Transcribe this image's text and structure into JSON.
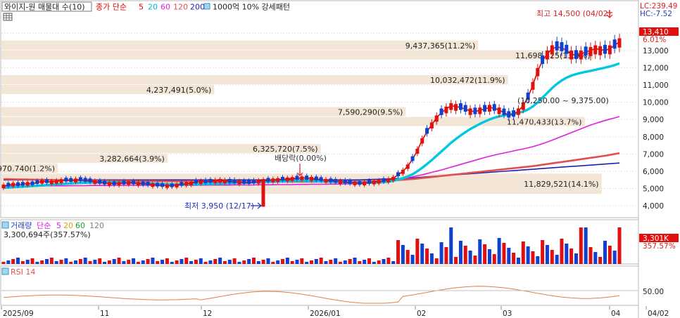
{
  "header": {
    "title": "와이지-원 매물대 수(10)",
    "ma_label": "종가 단순",
    "ma_periods": [
      "5",
      "20",
      "60",
      "120",
      "200"
    ],
    "ma_colors": [
      "#e00000",
      "#00c8e0",
      "#e020e0",
      "#e05050",
      "#2020b0"
    ],
    "extra": "1000억 10% 강세패턴"
  },
  "right_labels": {
    "lc": "LC:239.49",
    "hc": "HC:-7.52",
    "price_tag": "13,410",
    "price_pct": "6.01%",
    "volume_tag": "3,301K",
    "volume_pct": "357.57%"
  },
  "annotations": {
    "high": "최고 14,500 (04/02)",
    "low": "최저 3,950 (12/17)",
    "dividend": "배당락(0.00%)",
    "range": "(10,250.00 ~ 9,375.00)"
  },
  "volume_panel": {
    "title": "거래량",
    "ma_label": "단순",
    "ma_periods": [
      "5",
      "20",
      "60",
      "120"
    ],
    "ma_colors": [
      "#e020e0",
      "#e0a000",
      "#20a020",
      "#808080"
    ],
    "value": "3,300,694주(357.57%)"
  },
  "rsi_panel": {
    "title": "RSI 14",
    "level": "50.00"
  },
  "chart_data": [
    {
      "type": "candlestick",
      "name": "price",
      "y_ticks": [
        "14,000",
        "13,000",
        "12,000",
        "11,000",
        "10,000",
        "9,000",
        "8,000",
        "7,000",
        "6,000",
        "5,000",
        "4,000"
      ],
      "ylim": [
        3400,
        14700
      ],
      "x_labels": [
        "2025/09",
        "11",
        "12",
        "2026/01",
        "02",
        "03",
        "04",
        "04/02"
      ],
      "volume_profile": [
        {
          "label": "970,740(1.2%)",
          "price_low": 5870,
          "price_high": 6440,
          "pct": 1.2
        },
        {
          "label": "3,282,664(3.9%)",
          "price_low": 6440,
          "price_high": 7010,
          "pct": 3.9
        },
        {
          "label": "6,325,720(7.5%)",
          "price_low": 7010,
          "price_high": 7580,
          "pct": 7.5
        },
        {
          "label": "11,470,433(13.7%)",
          "price_low": 8580,
          "price_high": 9150,
          "pct": 13.7
        },
        {
          "label": "7,590,290(9.5%)",
          "price_low": 9150,
          "price_high": 9720,
          "pct": 9.5
        },
        {
          "label": "4,237,491(5.0%)",
          "price_low": 10430,
          "price_high": 11000,
          "pct": 5.0
        },
        {
          "label": "10,032,472(11.9%)",
          "price_low": 11000,
          "price_high": 11570,
          "pct": 11.9
        },
        {
          "label": "11,698,425(13.9%)",
          "price_low": 12430,
          "price_high": 13000,
          "pct": 13.9
        },
        {
          "label": "9,437,365(11.2%)",
          "price_low": 13000,
          "price_high": 13570,
          "pct": 11.2
        },
        {
          "label": "11,829,521(14.1%)",
          "price_low": 4650,
          "price_high": 5870,
          "pct": 14.1
        }
      ],
      "series": [
        {
          "name": "5",
          "values": [
            5150,
            5200,
            5250,
            5230,
            5250,
            5300,
            5280,
            5350,
            5420,
            5400,
            5380,
            5420,
            5460,
            5490,
            5470,
            5500,
            5520,
            5480,
            5450,
            5400,
            5360,
            5320,
            5300,
            5280,
            5300,
            5320,
            5350,
            5330,
            5300,
            5280,
            5260,
            5230,
            5200,
            5180,
            5170,
            5160,
            5200,
            5250,
            5300,
            5320,
            5380,
            5400,
            5390,
            5420,
            5450,
            5480,
            5440,
            5420,
            5400,
            5380,
            5360,
            5350,
            5380,
            5420,
            5460,
            5480,
            5500,
            5520,
            5540,
            5560,
            5580,
            5600,
            5620,
            5610,
            5590,
            5560,
            5520,
            5480,
            5450,
            5420,
            5400,
            5380,
            5350,
            5330,
            5300,
            5320,
            5360,
            5380,
            5420,
            5460,
            5500,
            5600,
            5800,
            6000,
            6300,
            6700,
            7200,
            7800,
            8300,
            8700,
            9100,
            9400,
            9600,
            9800,
            9750,
            9700,
            9600,
            9500,
            9450,
            9550,
            9600,
            9700,
            9650,
            9550,
            9400,
            9250,
            9300,
            9500,
            9800,
            10300,
            11000,
            11800,
            12400,
            12800,
            13100,
            13200,
            13150,
            13000,
            12800,
            12700,
            12800,
            12900,
            13000,
            13100,
            13050,
            13000,
            13100,
            13300,
            13500
          ]
        },
        {
          "name": "20",
          "values": [
            5050,
            5060,
            5080,
            5100,
            5110,
            5130,
            5150,
            5160,
            5180,
            5200,
            5220,
            5240,
            5260,
            5280,
            5300,
            5320,
            5330,
            5340,
            5350,
            5360,
            5370,
            5370,
            5370,
            5360,
            5350,
            5340,
            5330,
            5320,
            5310,
            5300,
            5290,
            5280,
            5270,
            5260,
            5250,
            5240,
            5240,
            5240,
            5240,
            5250,
            5250,
            5260,
            5260,
            5270,
            5280,
            5290,
            5300,
            5310,
            5320,
            5330,
            5340,
            5350,
            5360,
            5370,
            5380,
            5390,
            5400,
            5410,
            5420,
            5430,
            5440,
            5450,
            5450,
            5450,
            5440,
            5430,
            5420,
            5410,
            5400,
            5390,
            5380,
            5370,
            5360,
            5350,
            5340,
            5340,
            5340,
            5350,
            5360,
            5380,
            5400,
            5450,
            5520,
            5600,
            5700,
            5830,
            6000,
            6200,
            6420,
            6650,
            6900,
            7150,
            7400,
            7650,
            7870,
            8080,
            8270,
            8450,
            8600,
            8750,
            8880,
            9000,
            9100,
            9180,
            9240,
            9280,
            9320,
            9380,
            9460,
            9580,
            9760,
            9990,
            10260,
            10540,
            10820,
            11060,
            11260,
            11420,
            11540,
            11630,
            11700,
            11760,
            11820,
            11880,
            11940,
            12000,
            12070,
            12150,
            12250
          ]
        },
        {
          "name": "60",
          "values": [
            5150,
            5150,
            5150,
            5150,
            5150,
            5150,
            5150,
            5150,
            5150,
            5160,
            5160,
            5160,
            5160,
            5160,
            5170,
            5170,
            5170,
            5170,
            5180,
            5180,
            5180,
            5180,
            5180,
            5190,
            5190,
            5190,
            5190,
            5190,
            5190,
            5190,
            5190,
            5190,
            5190,
            5190,
            5190,
            5190,
            5190,
            5190,
            5190,
            5190,
            5190,
            5200,
            5200,
            5200,
            5200,
            5200,
            5200,
            5200,
            5210,
            5210,
            5210,
            5210,
            5210,
            5220,
            5220,
            5220,
            5220,
            5230,
            5230,
            5230,
            5230,
            5240,
            5240,
            5240,
            5250,
            5250,
            5250,
            5250,
            5260,
            5260,
            5260,
            5270,
            5270,
            5280,
            5290,
            5300,
            5320,
            5350,
            5380,
            5410,
            5450,
            5490,
            5530,
            5570,
            5620,
            5680,
            5740,
            5800,
            5870,
            5940,
            6010,
            6080,
            6160,
            6240,
            6320,
            6400,
            6480,
            6560,
            6640,
            6720,
            6800,
            6870,
            6940,
            7000,
            7060,
            7120,
            7180,
            7240,
            7300,
            7360,
            7430,
            7510,
            7600,
            7700,
            7800,
            7910,
            8020,
            8130,
            8240,
            8350,
            8460,
            8570,
            8680,
            8770,
            8860,
            8940,
            9020,
            9090,
            9170
          ]
        },
        {
          "name": "120",
          "values": [
            5550,
            5545,
            5540,
            5535,
            5530,
            5525,
            5520,
            5515,
            5510,
            5505,
            5500,
            5495,
            5490,
            5485,
            5480,
            5475,
            5470,
            5465,
            5460,
            5455,
            5450,
            5448,
            5446,
            5444,
            5442,
            5440,
            5438,
            5436,
            5434,
            5432,
            5430,
            5428,
            5426,
            5424,
            5422,
            5420,
            5418,
            5416,
            5414,
            5412,
            5410,
            5408,
            5406,
            5404,
            5402,
            5400,
            5400,
            5400,
            5400,
            5400,
            5400,
            5400,
            5400,
            5400,
            5400,
            5400,
            5400,
            5400,
            5400,
            5400,
            5400,
            5400,
            5400,
            5400,
            5400,
            5400,
            5400,
            5400,
            5400,
            5400,
            5400,
            5400,
            5400,
            5400,
            5400,
            5400,
            5410,
            5420,
            5430,
            5440,
            5450,
            5470,
            5490,
            5510,
            5530,
            5550,
            5580,
            5610,
            5640,
            5670,
            5700,
            5730,
            5760,
            5790,
            5820,
            5850,
            5880,
            5910,
            5940,
            5970,
            6000,
            6030,
            6060,
            6090,
            6120,
            6150,
            6180,
            6210,
            6240,
            6270,
            6300,
            6340,
            6380,
            6420,
            6460,
            6500,
            6540,
            6580,
            6620,
            6660,
            6700,
            6740,
            6780,
            6820,
            6860,
            6900,
            6950,
            7000,
            7050
          ]
        },
        {
          "name": "200",
          "values": [
            5500,
            5500,
            5500,
            5500,
            5500,
            5500,
            5500,
            5500,
            5500,
            5500,
            5500,
            5500,
            5500,
            5500,
            5500,
            5500,
            5500,
            5500,
            5500,
            5500,
            5500,
            5500,
            5500,
            5500,
            5500,
            5500,
            5500,
            5500,
            5500,
            5500,
            5500,
            5500,
            5500,
            5500,
            5500,
            5500,
            5500,
            5500,
            5500,
            5500,
            5500,
            5500,
            5500,
            5500,
            5500,
            5500,
            5500,
            5500,
            5500,
            5500,
            5500,
            5500,
            5500,
            5500,
            5500,
            5500,
            5500,
            5500,
            5500,
            5500,
            5500,
            5500,
            5500,
            5500,
            5500,
            5500,
            5500,
            5500,
            5500,
            5500,
            5500,
            5500,
            5500,
            5500,
            5500,
            5510,
            5520,
            5530,
            5540,
            5550,
            5560,
            5570,
            5580,
            5590,
            5600,
            5620,
            5640,
            5660,
            5680,
            5700,
            5720,
            5740,
            5760,
            5780,
            5800,
            5820,
            5840,
            5860,
            5880,
            5900,
            5920,
            5940,
            5960,
            5980,
            6000,
            6020,
            6040,
            6060,
            6080,
            6100,
            6120,
            6140,
            6160,
            6180,
            6200,
            6220,
            6240,
            6260,
            6280,
            6300,
            6320,
            6340,
            6360,
            6380,
            6400,
            6420,
            6440,
            6460,
            6480
          ]
        }
      ]
    },
    {
      "type": "bar",
      "name": "volume",
      "note": "volume bars in relative units (latest = 3,301K)"
    },
    {
      "type": "line",
      "name": "RSI 14",
      "ylim": [
        0,
        100
      ]
    }
  ]
}
